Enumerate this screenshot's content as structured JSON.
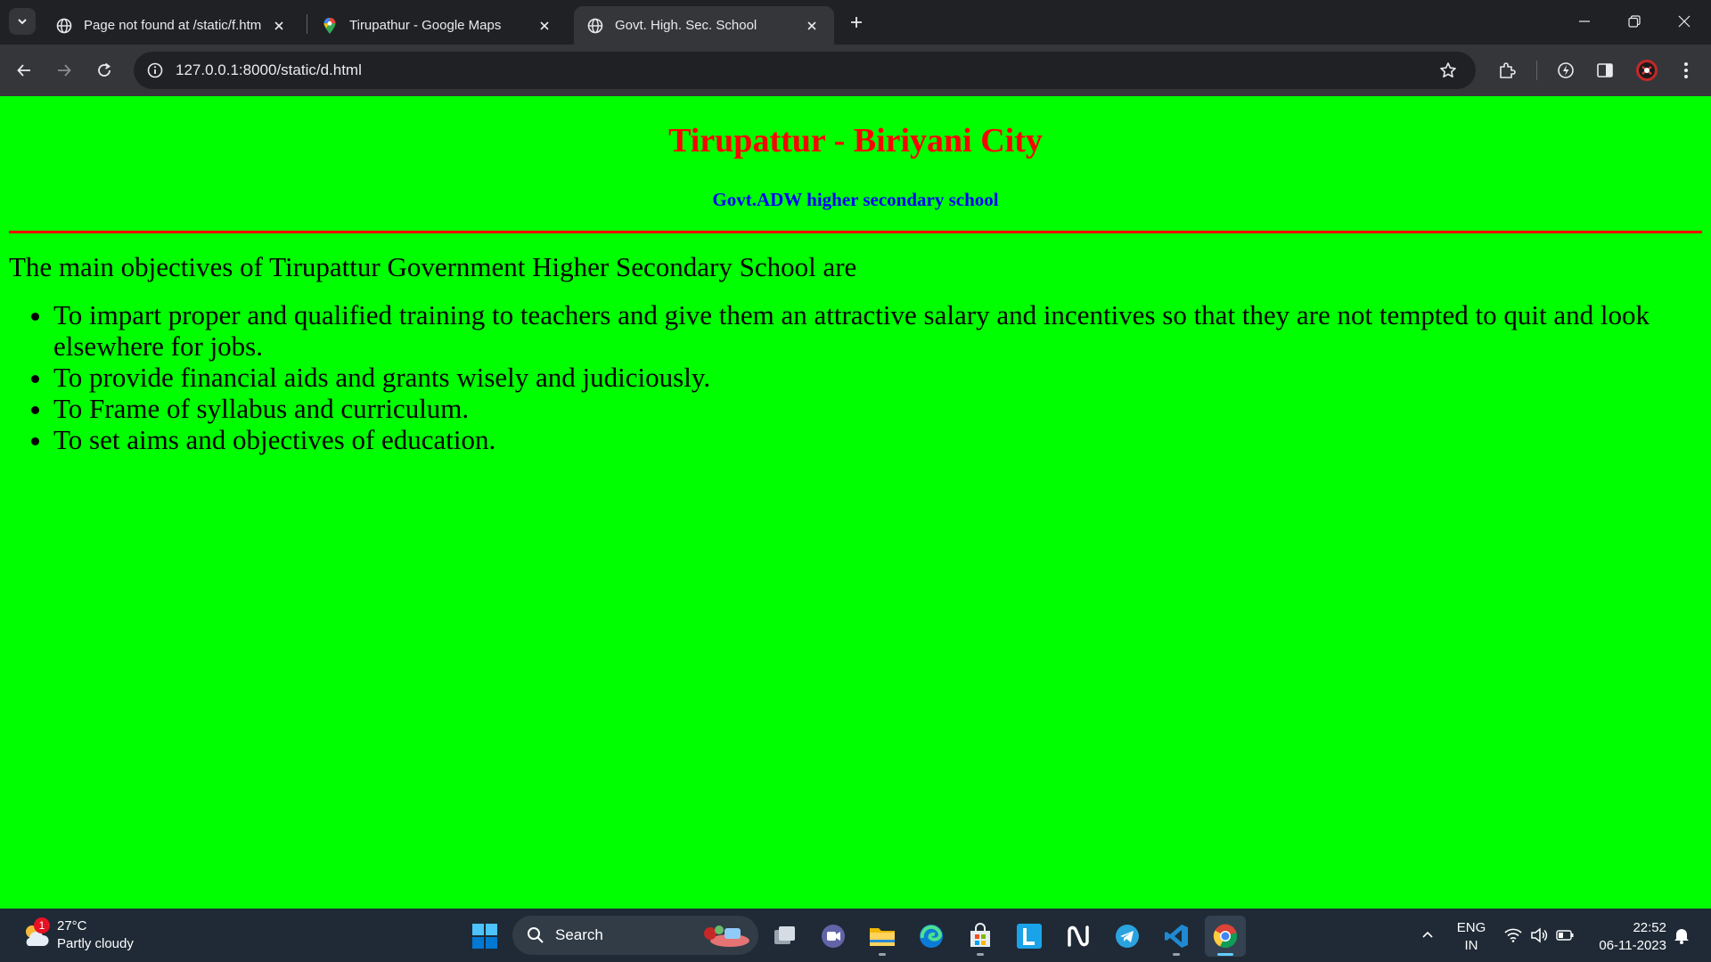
{
  "browser": {
    "tabs": [
      {
        "title": "Page not found at /static/f.htm",
        "favicon": "globe-icon",
        "active": false
      },
      {
        "title": "Tirupathur - Google Maps",
        "favicon": "maps-pin-icon",
        "active": false
      },
      {
        "title": "Govt. High. Sec. School",
        "favicon": "globe-icon",
        "active": true
      }
    ],
    "url": "127.0.0.1:8000/static/d.html"
  },
  "page": {
    "heading": "Tirupattur - Biriyani City",
    "subheading": "Govt.ADW higher secondary school",
    "intro": "The main objectives of Tirupattur Government Higher Secondary School are",
    "objectives": [
      "To impart proper and qualified training to teachers and give them an attractive salary and incentives so that they are not tempted to quit and look elsewhere for jobs.",
      "To provide financial aids and grants wisely and judiciously.",
      "To Frame of syllabus and curriculum.",
      "To set aims and objectives of education."
    ],
    "colors": {
      "background": "#00ff00",
      "heading": "#ff0000",
      "subheading": "#0000ff",
      "rule": "#ff0000"
    }
  },
  "taskbar": {
    "weather": {
      "temp": "27°C",
      "condition": "Partly cloudy",
      "badge": "1"
    },
    "search_label": "Search",
    "apps": [
      "task-view-icon",
      "meet-icon",
      "file-explorer-icon",
      "edge-icon",
      "microsoft-store-icon",
      "l-app-icon",
      "notion-like-icon",
      "telegram-icon",
      "vscode-icon",
      "chrome-icon"
    ],
    "language": {
      "line1": "ENG",
      "line2": "IN"
    },
    "time": "22:52",
    "date": "06-11-2023"
  }
}
